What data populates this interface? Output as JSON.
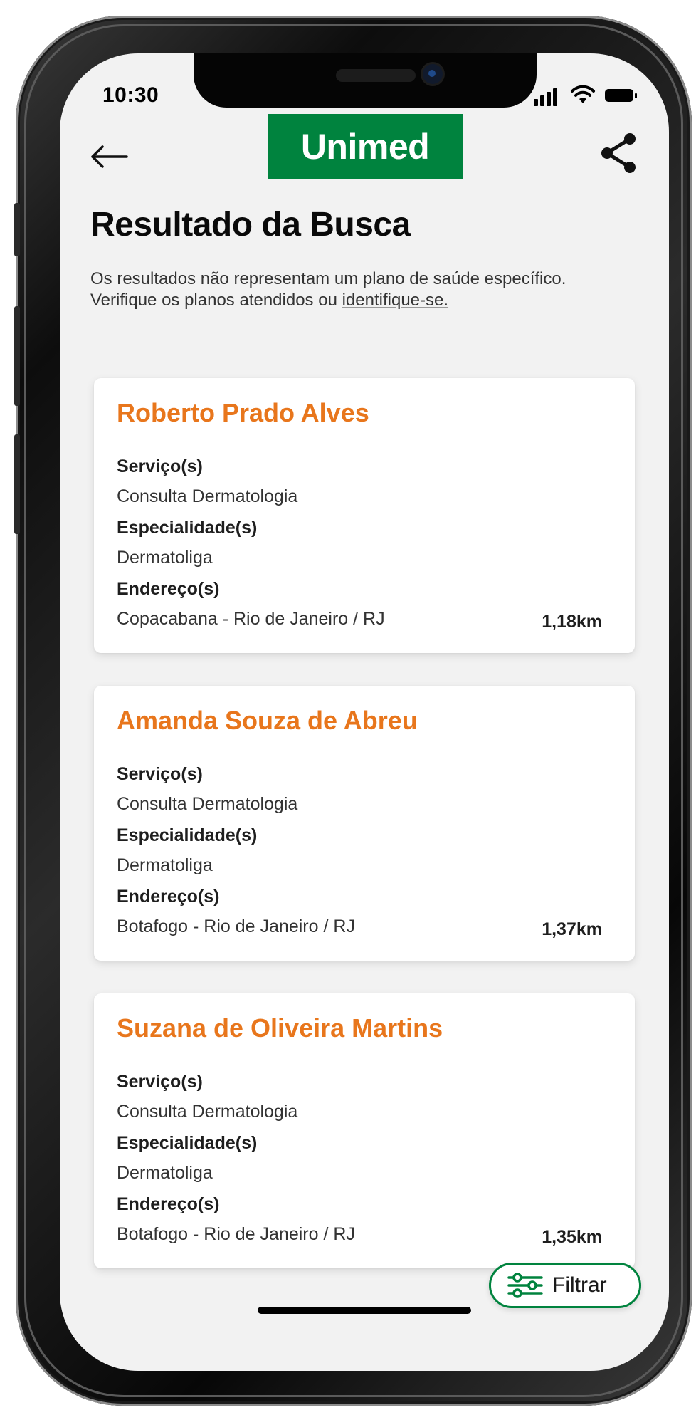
{
  "status_bar": {
    "time": "10:30"
  },
  "header": {
    "back_icon": "arrow-left-icon",
    "logo_text": "Unimed",
    "share_icon": "share-icon"
  },
  "page": {
    "title": "Resultado da Busca",
    "subtitle_text": "Os resultados não representam um plano de saúde específico. Verifique os planos atendidos ou ",
    "subtitle_link": "identifique-se."
  },
  "results": [
    {
      "name": "Roberto Prado Alves",
      "services_label": "Serviço(s)",
      "services": "Consulta Dermatologia",
      "specialties_label": "Especialidade(s)",
      "specialties": "Dermatoliga",
      "addresses_label": "Endereço(s)",
      "address": "Copacabana - Rio de Janeiro / RJ",
      "distance": "1,18km"
    },
    {
      "name": "Amanda Souza de Abreu",
      "services_label": "Serviço(s)",
      "services": "Consulta Dermatologia",
      "specialties_label": "Especialidade(s)",
      "specialties": "Dermatoliga",
      "addresses_label": "Endereço(s)",
      "address": "Botafogo - Rio de Janeiro / RJ",
      "distance": "1,37km"
    },
    {
      "name": "Suzana de Oliveira Martins",
      "services_label": "Serviço(s)",
      "services": "Consulta Dermatologia",
      "specialties_label": "Especialidade(s)",
      "specialties": "Dermatoliga",
      "addresses_label": "Endereço(s)",
      "address": "Botafogo - Rio de Janeiro / RJ",
      "distance": "1,35km"
    }
  ],
  "filter": {
    "label": "Filtrar",
    "icon": "sliders-icon"
  },
  "colors": {
    "brand_green": "#00833e",
    "accent_orange": "#e8761c",
    "screen_background": "#f2f2f2",
    "card_background": "#ffffff"
  }
}
